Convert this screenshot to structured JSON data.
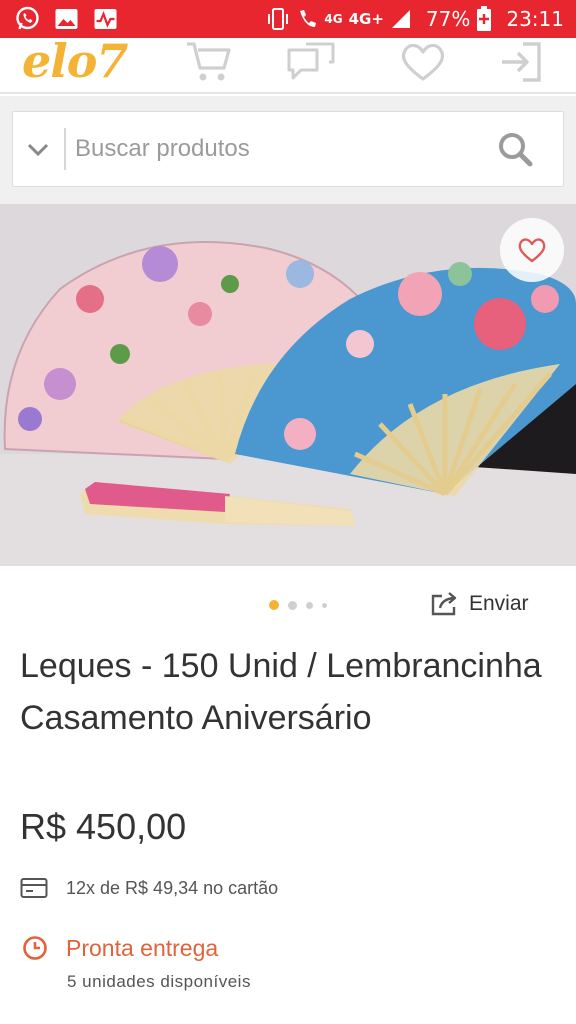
{
  "status_bar": {
    "network_small": "4G",
    "network": "4G+",
    "battery": "77%",
    "time": "23:11",
    "icons": [
      "whatsapp-icon",
      "gallery-icon",
      "activity-icon",
      "vibrate-icon",
      "volte-call-icon",
      "signal-icon",
      "battery-icon"
    ]
  },
  "header": {
    "logo": "elo7",
    "icons": [
      "cart-icon",
      "messages-icon",
      "favorites-icon",
      "login-icon"
    ]
  },
  "search": {
    "placeholder": "Buscar produtos"
  },
  "product": {
    "images_total": 4,
    "current_image": 1,
    "share_label": "Enviar",
    "title": "Leques - 150 Unid / Lembrancinha Casamento Aniversário",
    "price": "R$ 450,00",
    "installments": "12x de R$ 49,34 no cartão",
    "availability_title": "Pronta entrega",
    "availability_detail": "5 unidades disponíveis"
  },
  "colors": {
    "status_bar": "#e8262f",
    "logo": "#f5b335",
    "accent_orange": "#e0633a",
    "active_dot": "#f5b335",
    "heart": "#e05a5a"
  }
}
